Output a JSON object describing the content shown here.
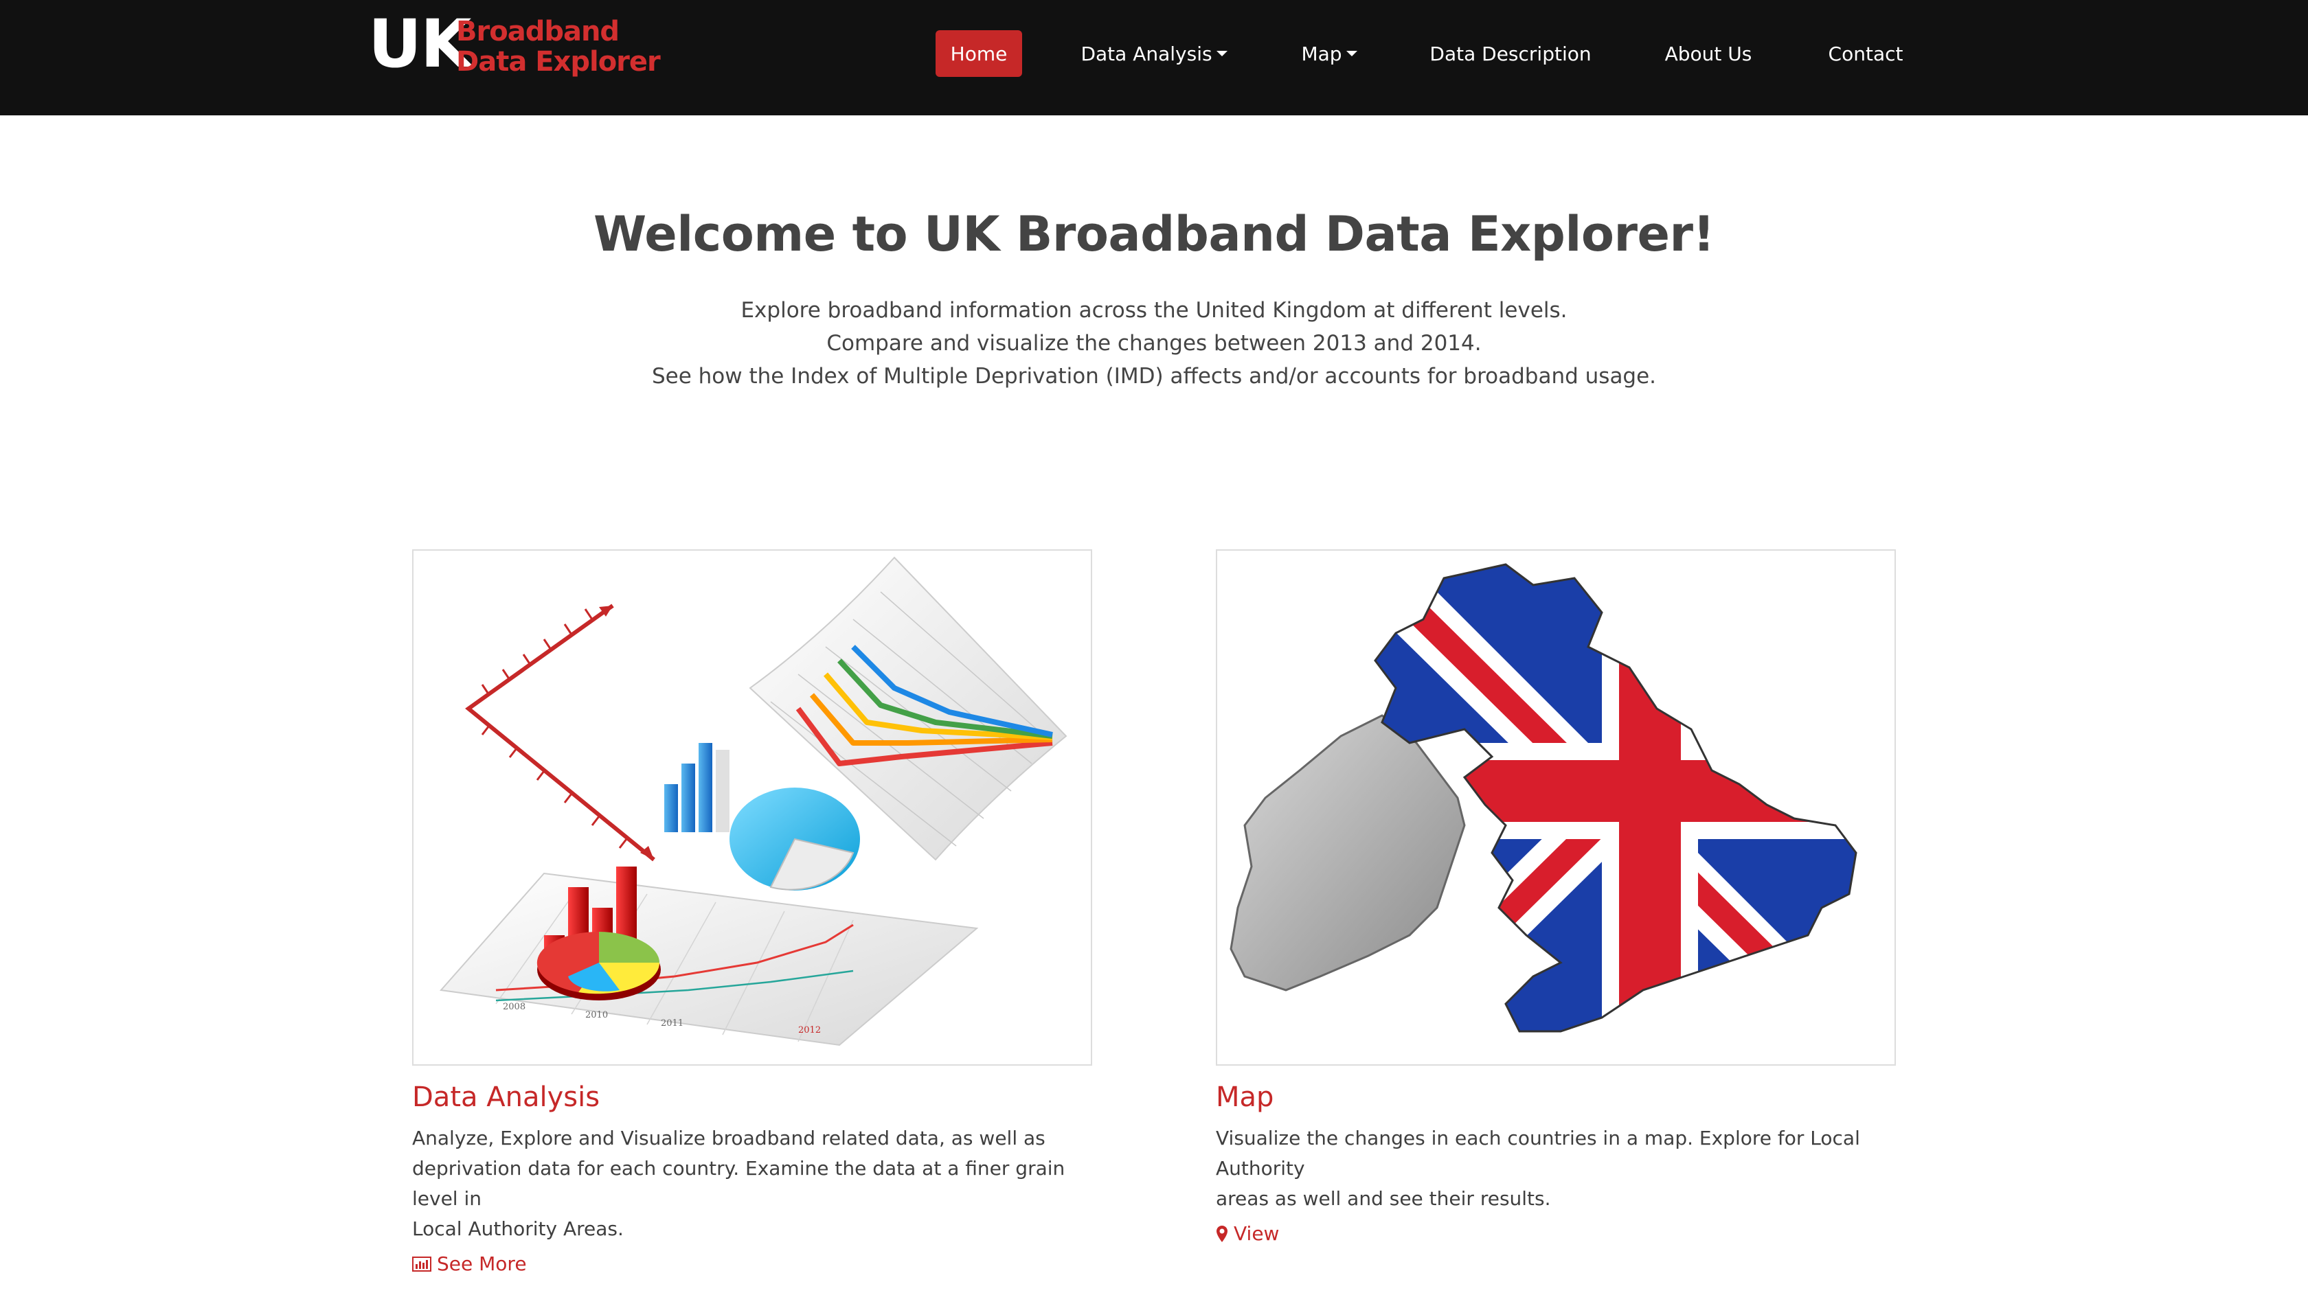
{
  "brand": {
    "uk": "UK",
    "line1": "Broadband",
    "line2": "Data Explorer"
  },
  "nav": {
    "items": [
      {
        "label": "Home",
        "active": true
      },
      {
        "label": "Data Analysis",
        "dropdown": true
      },
      {
        "label": "Map",
        "dropdown": true
      },
      {
        "label": "Data Description"
      },
      {
        "label": "About Us"
      },
      {
        "label": "Contact"
      }
    ]
  },
  "hero": {
    "title": "Welcome to UK Broadband Data Explorer!",
    "lines": [
      "Explore broadband information across the United Kingdom at different levels.",
      "Compare and visualize the changes between 2013 and 2014.",
      "See how the Index of Multiple Deprivation (IMD) affects and/or accounts for broadband usage."
    ]
  },
  "cards": [
    {
      "title": "Data Analysis",
      "text_lines": [
        "Analyze, Explore and Visualize broadband related data, as well as",
        "deprivation data for each country. Examine the data at a finer grain level in",
        "Local Authority Areas."
      ],
      "link": "See More",
      "link_icon": "bar-chart-icon",
      "image": "charts-illustration"
    },
    {
      "title": "Map",
      "text_lines": [
        "Visualize the changes in each countries in a map. Explore for Local Authority",
        "areas as well and see their results."
      ],
      "link": "View",
      "link_icon": "map-marker-icon",
      "image": "uk-flag-map-illustration"
    }
  ],
  "colors": {
    "navbar_bg": "#111111",
    "accent": "#c62828",
    "text": "#444444"
  }
}
